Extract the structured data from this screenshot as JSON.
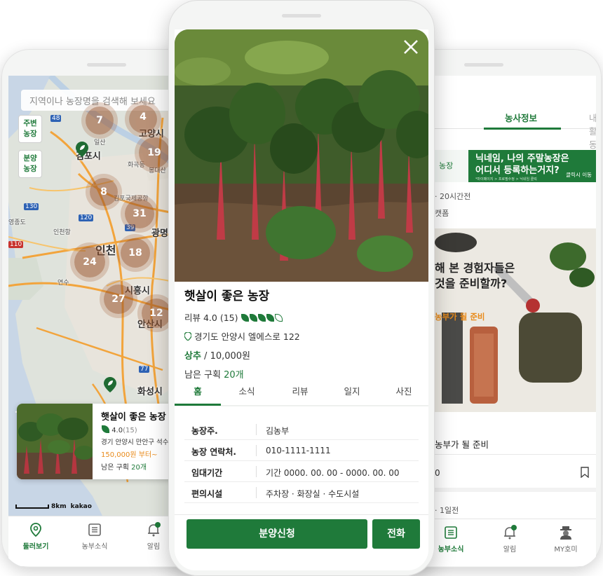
{
  "map_screen": {
    "search_placeholder": "지역이나 농장명을 검색해 보세요",
    "nearby_button": "주변\n농장",
    "sale_button": "분양\n농장",
    "clusters": [
      {
        "count": "7"
      },
      {
        "count": "4"
      },
      {
        "count": "19"
      },
      {
        "count": "8"
      },
      {
        "count": "31"
      },
      {
        "count": "18"
      },
      {
        "count": "24"
      },
      {
        "count": "27"
      },
      {
        "count": "12"
      }
    ],
    "places": [
      "김포시",
      "고양시",
      "인천",
      "광명",
      "시흥시",
      "안산시",
      "화성시",
      "영종도",
      "김포국제공항",
      "인천항",
      "일산",
      "화곡동",
      "봉대산",
      "연수"
    ],
    "road_numbers": [
      "48",
      "130",
      "120",
      "110",
      "39",
      "77"
    ],
    "farm_card": {
      "name": "햇살이 좋은 농장",
      "rating": "4.0",
      "review_count": "(15)",
      "address": "경기 안양시 만안구 석수",
      "price": "150,000원 부터~",
      "remaining_label": "남은 구획",
      "remaining_value": "20개"
    },
    "scale_label": "8km",
    "map_brand": "kakao",
    "tabs": [
      {
        "label": "둘러보기"
      },
      {
        "label": "농부소식"
      },
      {
        "label": "알림"
      }
    ],
    "badge": "N"
  },
  "detail_screen": {
    "farm_name": "햇살이 좋은 농장",
    "review_text": "리뷰 4.0 (15)",
    "rating": 4.0,
    "address": "경기도 안양시 엘에스로 122",
    "crop_name": "상추",
    "crop_price": " / 10,000원",
    "remaining_label": "남은 구획 ",
    "remaining_value": "20개",
    "tabs": [
      {
        "label": "홈"
      },
      {
        "label": "소식"
      },
      {
        "label": "리뷰"
      },
      {
        "label": "일지"
      },
      {
        "label": "사진"
      }
    ],
    "spec": [
      {
        "key": "농장주.",
        "value": "김농부"
      },
      {
        "key": "농장 연락처.",
        "value": "010-1111-1111"
      },
      {
        "key": "임대기간",
        "value": "기간 0000. 00. 00 - 0000. 00. 00"
      },
      {
        "key": "편의시설",
        "value": "주차장 · 화장실 · 수도시설"
      }
    ],
    "apply_button": "분양신청",
    "call_button": "전화"
  },
  "feed_screen": {
    "tabs": [
      {
        "label": "농사정보"
      },
      {
        "label": "내활동"
      }
    ],
    "banner_left": "농장",
    "banner_title": "닉네임, 나의 주말농장은\n어디서 등록하는거지?",
    "banner_sub": "*마이페이지 > 프로필수정 > 닉네임 클릭",
    "banner_cta": "클릭시 이동",
    "post_meta": "20시간전",
    "post_category": "캣폼",
    "photo_title_line1": "해 본 경험자들은",
    "photo_title_line2": "것을 준비할까?",
    "photo_subtitle": "농부가 될 준비",
    "caption": "농부가 될 준비",
    "like_count": "0",
    "next_meta": "1일전",
    "tabs_bottom": [
      {
        "label": "농부소식"
      },
      {
        "label": "알림"
      },
      {
        "label": "MY호미"
      }
    ],
    "badge": "N"
  },
  "colors": {
    "brand_green": "#1f7a3a",
    "price_orange": "#e88a1a",
    "cluster_brown": "#96502a"
  }
}
